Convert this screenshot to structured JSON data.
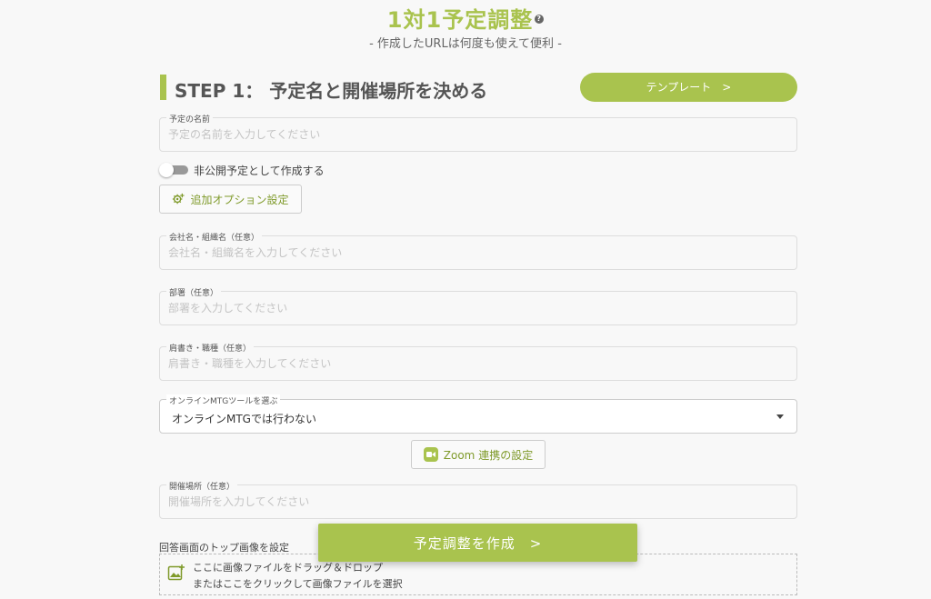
{
  "header": {
    "title": "1対1予定調整",
    "help_symbol": "?",
    "subtitle": "- 作成したURLは何度も使えて便利 -"
  },
  "step": {
    "title": "STEP 1： 予定名と開催場所を決める",
    "template_button": "テンプレート　>"
  },
  "fields": {
    "event_name": {
      "label": "予定の名前",
      "placeholder": "予定の名前を入力してください"
    },
    "company": {
      "label": "会社名・組織名（任意）",
      "placeholder": "会社名・組織名を入力してください"
    },
    "department": {
      "label": "部署（任意）",
      "placeholder": "部署を入力してください"
    },
    "position": {
      "label": "肩書き・職種（任意）",
      "placeholder": "肩書き・職種を入力してください"
    },
    "location": {
      "label": "開催場所（任意）",
      "placeholder": "開催場所を入力してください"
    }
  },
  "private_toggle": {
    "label": "非公開予定として作成する",
    "on": false
  },
  "options_button": "追加オプション設定",
  "mtg_tool": {
    "label": "オンラインMTGツールを選ぶ",
    "selected": "オンラインMTGでは行わない"
  },
  "zoom_button": "Zoom 連携の設定",
  "image_upload": {
    "label": "回答画面のトップ画像を設定",
    "line1": "ここに画像ファイルをドラッグ＆ドロップ",
    "line2": "またはここをクリックして画像ファイルを選択"
  },
  "create_button": "予定調整を作成　>",
  "colors": {
    "accent": "#a9c34e",
    "text": "#444444",
    "border": "#dddddd"
  }
}
